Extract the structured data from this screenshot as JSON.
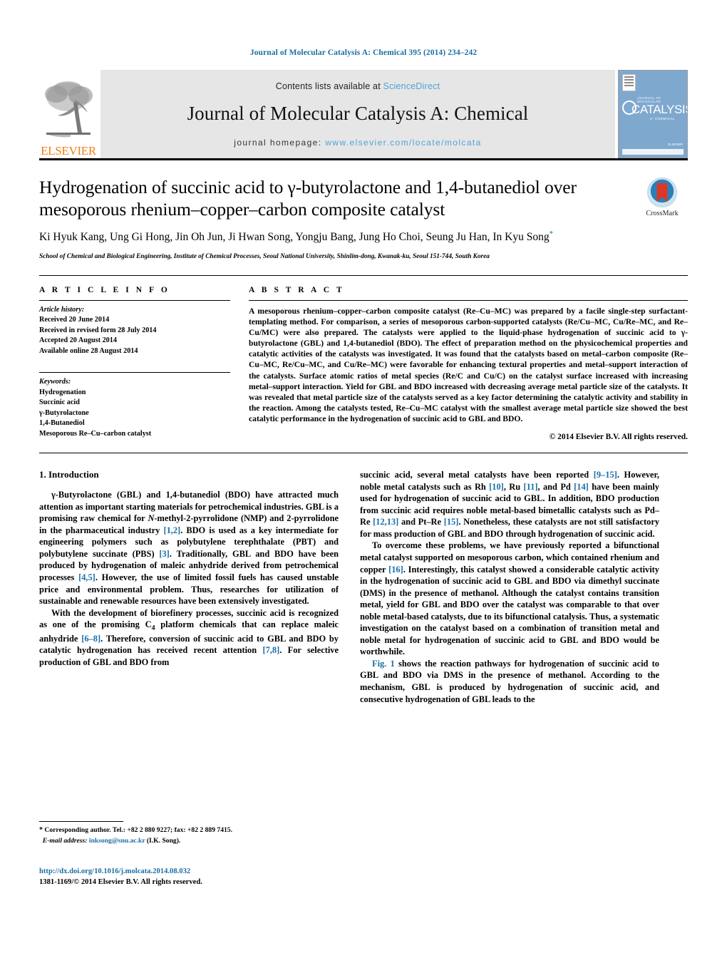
{
  "running_head": "Journal of Molecular Catalysis A: Chemical 395 (2014) 234–242",
  "masthead": {
    "publisher_name": "ELSEVIER",
    "contents_prefix": "Contents lists available at ",
    "sciencedirect": "ScienceDirect",
    "journal_title": "Journal of Molecular Catalysis A: Chemical",
    "homepage_label": "journal homepage:",
    "homepage_url": "www.elsevier.com/locate/molcata",
    "cover": {
      "kicker": "JOURNAL OF MOLECULAR",
      "big": "CATALYSIS",
      "sub": "A: CHEMICAL",
      "footer": "ELSEVIER"
    }
  },
  "article": {
    "title": "Hydrogenation of succinic acid to γ-butyrolactone and 1,4-butanediol over mesoporous rhenium–copper–carbon composite catalyst",
    "authors": "Ki Hyuk Kang, Ung Gi Hong, Jin Oh Jun, Ji Hwan Song, Yongju Bang, Jung Ho Choi, Seung Ju Han, In Kyu Song",
    "affiliation": "School of Chemical and Biological Engineering, Institute of Chemical Processes, Seoul National University, Shinlim-dong, Kwanak-ku, Seoul 151-744, South Korea",
    "crossmark_label": "CrossMark"
  },
  "article_info": {
    "heading": "A R T I C L E    I N F O",
    "history_heading": "Article history:",
    "history": [
      "Received 20 June 2014",
      "Received in revised form 28 July 2014",
      "Accepted 20 August 2014",
      "Available online 28 August 2014"
    ],
    "keywords_heading": "Keywords:",
    "keywords": [
      "Hydrogenation",
      "Succinic acid",
      "γ-Butyrolactone",
      "1,4-Butanediol",
      "Mesoporous Re–Cu–carbon catalyst"
    ]
  },
  "abstract": {
    "heading": "A B S T R A C T",
    "text": "A mesoporous rhenium–copper–carbon composite catalyst (Re–Cu–MC) was prepared by a facile single-step surfactant-templating method. For comparison, a series of mesoporous carbon-supported catalysts (Re/Cu–MC, Cu/Re–MC, and Re–Cu/MC) were also prepared. The catalysts were applied to the liquid-phase hydrogenation of succinic acid to γ-butyrolactone (GBL) and 1,4-butanediol (BDO). The effect of preparation method on the physicochemical properties and catalytic activities of the catalysts was investigated. It was found that the catalysts based on metal–carbon composite (Re–Cu–MC, Re/Cu–MC, and Cu/Re–MC) were favorable for enhancing textural properties and metal–support interaction of the catalysts. Surface atomic ratios of metal species (Re/C and Cu/C) on the catalyst surface increased with increasing metal–support interaction. Yield for GBL and BDO increased with decreasing average metal particle size of the catalysts. It was revealed that metal particle size of the catalysts served as a key factor determining the catalytic activity and stability in the reaction. Among the catalysts tested, Re–Cu–MC catalyst with the smallest average metal particle size showed the best catalytic performance in the hydrogenation of succinic acid to GBL and BDO.",
    "copyright": "© 2014 Elsevier B.V. All rights reserved."
  },
  "introduction": {
    "heading": "1.  Introduction",
    "left_p1_a": "γ-Butyrolactone (GBL) and 1,4-butanediol (BDO) have attracted much attention as important starting materials for petrochemical industries. GBL is a promising raw chemical for ",
    "left_p1_nmethyl": "N",
    "left_p1_b": "-methyl-2-pyrrolidone (NMP) and 2-pyrrolidone in the pharmaceutical industry ",
    "ref_1_2": "[1,2]",
    "left_p1_c": ". BDO is used as a key intermediate for engineering polymers such as polybutylene terephthalate (PBT) and polybutylene succinate (PBS) ",
    "ref_3": "[3]",
    "left_p1_d": ". Traditionally, GBL and BDO have been produced by hydrogenation of maleic anhydride derived from petrochemical processes ",
    "ref_4_5": "[4,5]",
    "left_p1_e": ". However, the use of limited fossil fuels has caused unstable price and environmental problem. Thus, researches for utilization of sustainable and renewable resources have been extensively investigated.",
    "left_p2_a": "With the development of biorefinery processes, succinic acid is recognized as one of the promising C",
    "left_p2_sub": "4",
    "left_p2_b": " platform chemicals that can replace maleic anhydride ",
    "ref_6_8": "[6–8]",
    "left_p2_c": ". Therefore, conversion of succinic acid to GBL and BDO by catalytic hydrogenation has received recent attention ",
    "ref_7_8": "[7,8]",
    "left_p2_d": ". For selective production of GBL and BDO from",
    "right_p1_a": "succinic acid, several metal catalysts have been reported ",
    "ref_9_15": "[9–15]",
    "right_p1_b": ". However, noble metal catalysts such as Rh ",
    "ref_10": "[10]",
    "right_p1_c": ", Ru ",
    "ref_11": "[11]",
    "right_p1_d": ", and Pd ",
    "ref_14": "[14]",
    "right_p1_e": " have been mainly used for hydrogenation of succinic acid to GBL. In addition, BDO production from succinic acid requires noble metal-based bimetallic catalysts such as Pd–Re ",
    "ref_12_13": "[12,13]",
    "right_p1_f": " and Pt–Re ",
    "ref_15": "[15]",
    "right_p1_g": ". Nonetheless, these catalysts are not still satisfactory for mass production of GBL and BDO through hydrogenation of succinic acid.",
    "right_p2_a": "To overcome these problems, we have previously reported a bifunctional metal catalyst supported on mesoporous carbon, which contained rhenium and copper ",
    "ref_16": "[16]",
    "right_p2_b": ". Interestingly, this catalyst showed a considerable catalytic activity in the hydrogenation of succinic acid to GBL and BDO via dimethyl succinate (DMS) in the presence of methanol. Although the catalyst contains transition metal, yield for GBL and BDO over the catalyst was comparable to that over noble metal-based catalysts, due to its bifunctional catalysis. Thus, a systematic investigation on the catalyst based on a combination of transition metal and noble metal for hydrogenation of succinic acid to GBL and BDO would be worthwhile.",
    "fig_ref": "Fig. 1",
    "right_p3_a": " shows the reaction pathways for hydrogenation of succinic acid to GBL and BDO via DMS in the presence of methanol. According to the mechanism, GBL is produced by hydrogenation of succinic acid, and consecutive hydrogenation of GBL leads to the"
  },
  "footer": {
    "corresponding_marker": "*",
    "corresponding_text": "Corresponding author. Tel.: +82 2 880 9227; fax: +82 2 889 7415.",
    "email_label": "E-mail address:",
    "email": "inksong@snu.ac.kr",
    "email_suffix": "(I.K. Song).",
    "doi": "http://dx.doi.org/10.1016/j.molcata.2014.08.032",
    "issn_line": "1381-1169/© 2014 Elsevier B.V. All rights reserved."
  },
  "colors": {
    "link_blue": "#1b6ea5",
    "sciencedirect_blue": "#4ea3d8",
    "elsevier_orange": "#f07f1a",
    "banner_gray": "#e6e6e6",
    "crossmark_red": "#d8382a",
    "crossmark_blue": "#2b7fb8"
  }
}
